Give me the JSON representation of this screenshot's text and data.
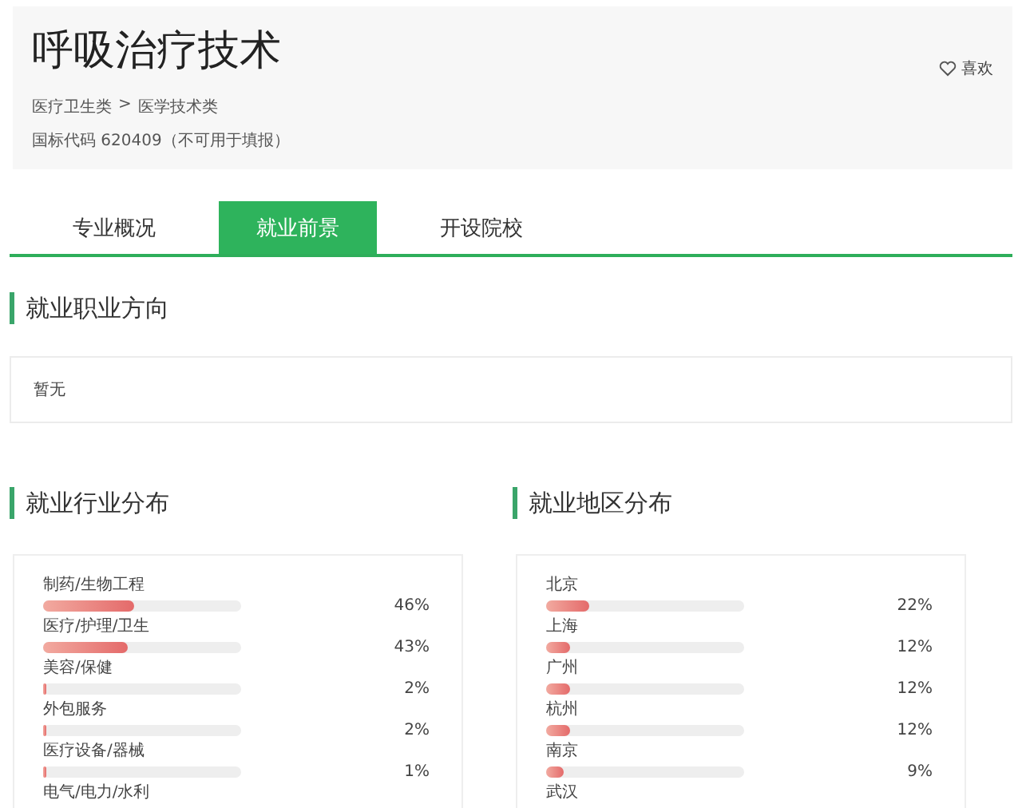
{
  "header": {
    "title": "呼吸治疗技术",
    "like_label": "喜欢",
    "breadcrumb": [
      "医疗卫生类",
      "医学技术类"
    ],
    "breadcrumb_separator": ">",
    "code_line": "国标代码 620409（不可用于填报）"
  },
  "tabs": [
    {
      "label": "专业概况",
      "selected": false
    },
    {
      "label": "就业前景",
      "selected": true
    },
    {
      "label": "开设院校",
      "selected": false
    }
  ],
  "career_direction": {
    "title": "就业职业方向",
    "text": "暂无"
  },
  "industry": {
    "title": "就业行业分布",
    "items": [
      {
        "name": "制药/生物工程",
        "level": 0.46,
        "reading": "46%"
      },
      {
        "name": "医疗/护理/卫生",
        "level": 0.43,
        "reading": "43%"
      },
      {
        "name": "美容/保健",
        "level": 0.02,
        "reading": "2%"
      },
      {
        "name": "外包服务",
        "level": 0.02,
        "reading": "2%"
      },
      {
        "name": "医疗设备/器械",
        "level": 0.01,
        "reading": "1%"
      },
      {
        "name": "电气/电力/水利"
      }
    ]
  },
  "region": {
    "title": "就业地区分布",
    "items": [
      {
        "name": "北京",
        "level": 0.22,
        "reading": "22%"
      },
      {
        "name": "上海",
        "level": 0.12,
        "reading": "12%"
      },
      {
        "name": "广州",
        "level": 0.12,
        "reading": "12%"
      },
      {
        "name": "杭州",
        "level": 0.12,
        "reading": "12%"
      },
      {
        "name": "南京",
        "level": 0.09,
        "reading": "9%"
      },
      {
        "name": "武汉"
      }
    ]
  }
}
